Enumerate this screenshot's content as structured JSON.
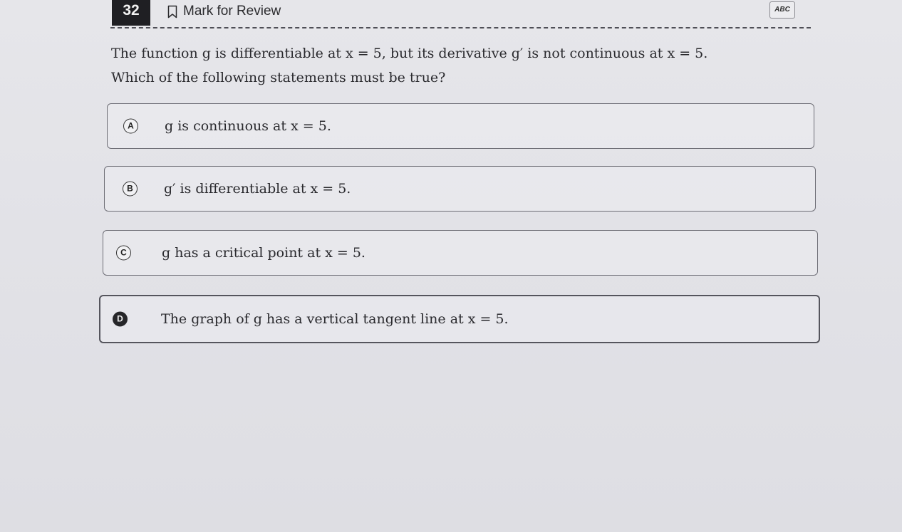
{
  "header": {
    "question_number": "32",
    "mark_label": "Mark for Review",
    "tool_label": "ABC"
  },
  "question": {
    "line1": "The function g is differentiable at x = 5, but its derivative g′ is not continuous at x = 5.",
    "line2": "Which of the following statements must be true?"
  },
  "options": [
    {
      "letter": "A",
      "text": "g is continuous at x = 5."
    },
    {
      "letter": "B",
      "text": "g′ is differentiable at x = 5."
    },
    {
      "letter": "C",
      "text": "g has a critical point at x = 5."
    },
    {
      "letter": "D",
      "text": "The graph of g has a vertical tangent line at x = 5."
    }
  ],
  "selected_option": "D"
}
